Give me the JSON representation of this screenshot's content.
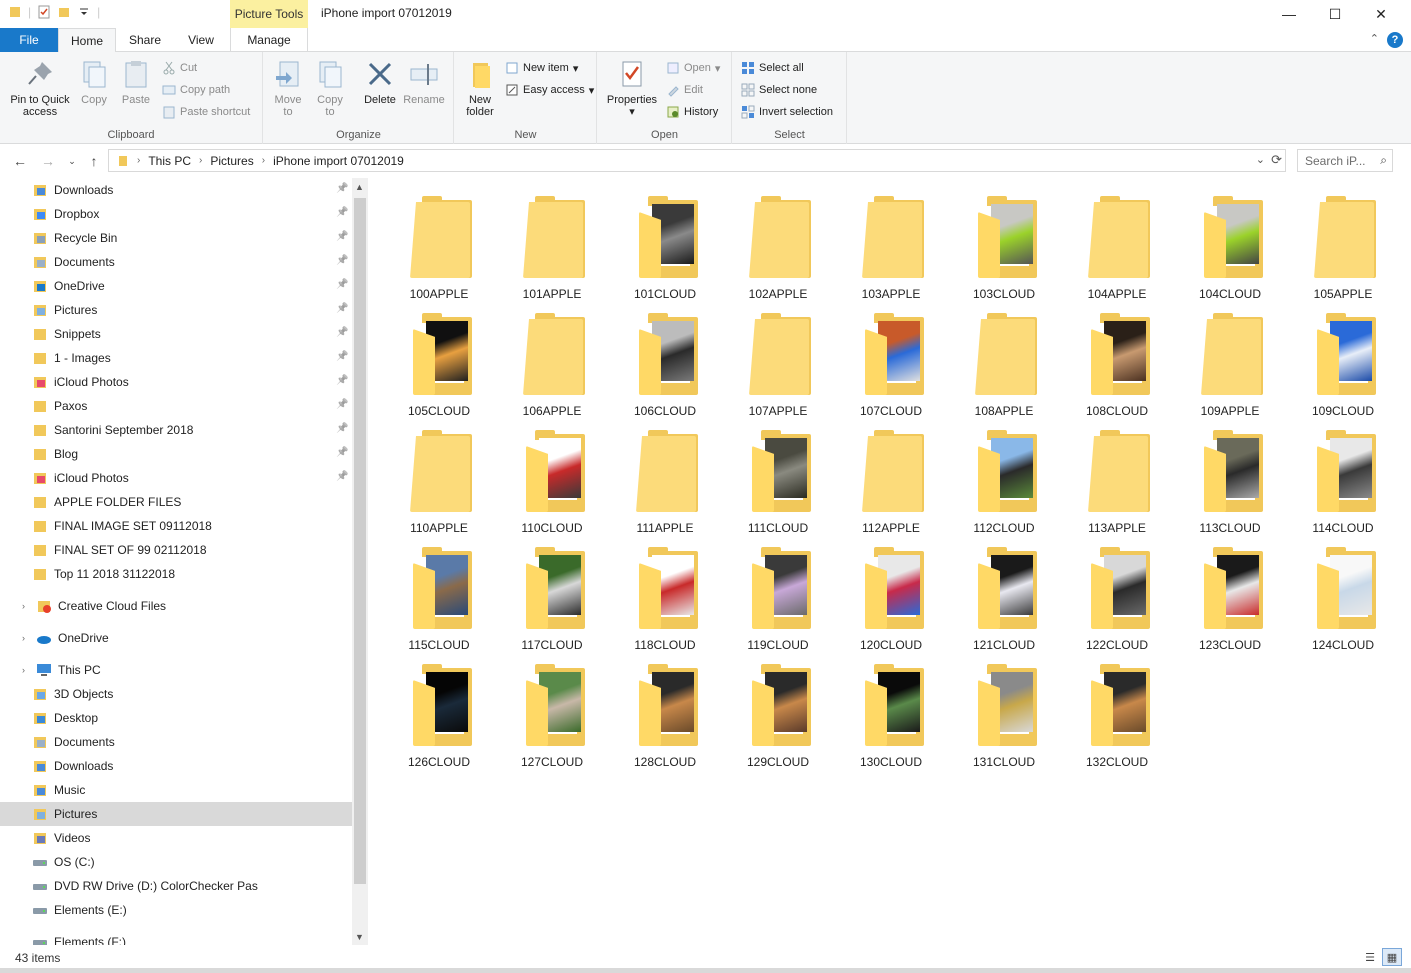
{
  "window": {
    "title": "iPhone import 07012019",
    "contextual_tab": "Picture Tools",
    "minimize_glyph": "—",
    "maximize_glyph": "☐",
    "close_glyph": "✕"
  },
  "tabs": [
    {
      "label": "File"
    },
    {
      "label": "Home"
    },
    {
      "label": "Share"
    },
    {
      "label": "View"
    },
    {
      "label": "Manage"
    }
  ],
  "ribbon": {
    "clipboard": {
      "label": "Clipboard",
      "pin": "Pin to Quick access",
      "copy": "Copy",
      "paste": "Paste",
      "cut": "Cut",
      "copy_path": "Copy path",
      "paste_shortcut": "Paste shortcut"
    },
    "organize": {
      "label": "Organize",
      "move_to": "Move to",
      "copy_to": "Copy to",
      "delete": "Delete",
      "rename": "Rename"
    },
    "new": {
      "label": "New",
      "new_folder": "New folder",
      "new_item": "New item",
      "easy_access": "Easy access"
    },
    "open": {
      "label": "Open",
      "properties": "Properties",
      "open": "Open",
      "edit": "Edit",
      "history": "History"
    },
    "select": {
      "label": "Select",
      "select_all": "Select all",
      "select_none": "Select none",
      "invert": "Invert selection"
    }
  },
  "address": {
    "crumbs": [
      "This PC",
      "Pictures",
      "iPhone import 07012019"
    ],
    "search_placeholder": "Search iP..."
  },
  "nav": {
    "quick_access": [
      {
        "label": "Downloads",
        "icon": "download-folder-icon",
        "pinned": true
      },
      {
        "label": "Dropbox",
        "icon": "dropbox-icon",
        "pinned": true
      },
      {
        "label": "Recycle Bin",
        "icon": "recycle-bin-icon",
        "pinned": true
      },
      {
        "label": "Documents",
        "icon": "documents-folder-icon",
        "pinned": true
      },
      {
        "label": "OneDrive",
        "icon": "onedrive-folder-icon",
        "pinned": true
      },
      {
        "label": "Pictures",
        "icon": "pictures-folder-icon",
        "pinned": true
      },
      {
        "label": "Snippets",
        "icon": "folder-icon",
        "pinned": true
      },
      {
        "label": "1 - Images",
        "icon": "folder-icon",
        "pinned": true
      },
      {
        "label": "iCloud Photos",
        "icon": "icloud-photos-icon",
        "pinned": true
      },
      {
        "label": "Paxos",
        "icon": "folder-icon",
        "pinned": true
      },
      {
        "label": "Santorini September 2018",
        "icon": "folder-icon",
        "pinned": true
      },
      {
        "label": "Blog",
        "icon": "folder-icon",
        "pinned": true
      },
      {
        "label": "iCloud Photos",
        "icon": "icloud-photos-icon",
        "pinned": true
      },
      {
        "label": "APPLE FOLDER FILES",
        "icon": "folder-icon",
        "pinned": false
      },
      {
        "label": "FINAL IMAGE SET 09112018",
        "icon": "folder-icon",
        "pinned": false
      },
      {
        "label": "FINAL SET OF 99 02112018",
        "icon": "folder-icon",
        "pinned": false
      },
      {
        "label": "Top 11 2018 31122018",
        "icon": "folder-icon",
        "pinned": false
      }
    ],
    "creative_cloud": "Creative Cloud Files",
    "onedrive": "OneDrive",
    "this_pc": "This PC",
    "this_pc_items": [
      {
        "label": "3D Objects",
        "icon": "3d-objects-icon"
      },
      {
        "label": "Desktop",
        "icon": "desktop-icon"
      },
      {
        "label": "Documents",
        "icon": "documents-folder-icon"
      },
      {
        "label": "Downloads",
        "icon": "download-folder-icon"
      },
      {
        "label": "Music",
        "icon": "music-folder-icon"
      },
      {
        "label": "Pictures",
        "icon": "pictures-folder-icon",
        "selected": true
      },
      {
        "label": "Videos",
        "icon": "videos-folder-icon"
      },
      {
        "label": "OS (C:)",
        "icon": "os-drive-icon"
      },
      {
        "label": "DVD RW Drive (D:) ColorChecker Pas",
        "icon": "dvd-drive-icon"
      },
      {
        "label": "Elements (E:)",
        "icon": "drive-icon"
      },
      {
        "label": "Elements (F:)",
        "icon": "drive-icon"
      }
    ]
  },
  "folders": [
    {
      "name": "100APPLE",
      "thumb": "empty"
    },
    {
      "name": "101APPLE",
      "thumb": "empty"
    },
    {
      "name": "101CLOUD",
      "thumb": "photo",
      "colors": [
        "#3a3a3a",
        "#8a8a8a",
        "#1a1a1a"
      ]
    },
    {
      "name": "102APPLE",
      "thumb": "empty"
    },
    {
      "name": "103APPLE",
      "thumb": "empty"
    },
    {
      "name": "103CLOUD",
      "thumb": "photo",
      "colors": [
        "#c8c8c4",
        "#9bd22a",
        "#555555"
      ]
    },
    {
      "name": "104APPLE",
      "thumb": "empty"
    },
    {
      "name": "104CLOUD",
      "thumb": "photo",
      "colors": [
        "#c8c8c4",
        "#9bd22a",
        "#444444"
      ]
    },
    {
      "name": "105APPLE",
      "thumb": "empty"
    },
    {
      "name": "105CLOUD",
      "thumb": "photo",
      "colors": [
        "#101010",
        "#e8a040",
        "#202020"
      ]
    },
    {
      "name": "106APPLE",
      "thumb": "empty"
    },
    {
      "name": "106CLOUD",
      "thumb": "photo",
      "colors": [
        "#bcbcbc",
        "#2a2a2a",
        "#7a7a7a"
      ]
    },
    {
      "name": "107APPLE",
      "thumb": "empty"
    },
    {
      "name": "107CLOUD",
      "thumb": "photo",
      "colors": [
        "#c85a2a",
        "#2a6ad8",
        "#e0e0e0"
      ]
    },
    {
      "name": "108APPLE",
      "thumb": "empty"
    },
    {
      "name": "108CLOUD",
      "thumb": "photo",
      "colors": [
        "#2a2018",
        "#c89a70",
        "#4a3020"
      ]
    },
    {
      "name": "109APPLE",
      "thumb": "empty"
    },
    {
      "name": "109CLOUD",
      "thumb": "photo",
      "colors": [
        "#2a6ad8",
        "#e8eef8",
        "#1a4aa8"
      ]
    },
    {
      "name": "110APPLE",
      "thumb": "empty"
    },
    {
      "name": "110CLOUD",
      "thumb": "photo",
      "colors": [
        "#ffffff",
        "#c82a2a",
        "#3a3a3a"
      ]
    },
    {
      "name": "111APPLE",
      "thumb": "empty"
    },
    {
      "name": "111CLOUD",
      "thumb": "photo",
      "colors": [
        "#4a4a40",
        "#8a8a80",
        "#2a2a20"
      ]
    },
    {
      "name": "112APPLE",
      "thumb": "empty"
    },
    {
      "name": "112CLOUD",
      "thumb": "photo",
      "colors": [
        "#8ab8e8",
        "#2a2a2a",
        "#5a8a3a"
      ]
    },
    {
      "name": "113APPLE",
      "thumb": "empty"
    },
    {
      "name": "113CLOUD",
      "thumb": "photo",
      "colors": [
        "#6a6a5a",
        "#2a2a2a",
        "#aaaaaa"
      ]
    },
    {
      "name": "114CLOUD",
      "thumb": "photo",
      "colors": [
        "#e8e8e8",
        "#3a3a3a",
        "#8a8a8a"
      ]
    },
    {
      "name": "115CLOUD",
      "thumb": "photo",
      "colors": [
        "#5a7aa8",
        "#8a6a4a",
        "#2a4a78"
      ]
    },
    {
      "name": "117CLOUD",
      "thumb": "photo",
      "colors": [
        "#3a6a2a",
        "#d8d8d8",
        "#2a2a2a"
      ]
    },
    {
      "name": "118CLOUD",
      "thumb": "photo",
      "colors": [
        "#ffffff",
        "#c82a2a",
        "#e8e8e8"
      ]
    },
    {
      "name": "119CLOUD",
      "thumb": "photo",
      "colors": [
        "#3a3a3a",
        "#c8a8d8",
        "#6a6a6a"
      ]
    },
    {
      "name": "120CLOUD",
      "thumb": "photo",
      "colors": [
        "#e8e8e8",
        "#c82a4a",
        "#2a6ad8"
      ]
    },
    {
      "name": "121CLOUD",
      "thumb": "photo",
      "colors": [
        "#1a1a1a",
        "#e8e8f0",
        "#3a3a3a"
      ]
    },
    {
      "name": "122CLOUD",
      "thumb": "photo",
      "colors": [
        "#d8d8d8",
        "#2a2a2a",
        "#6a6a6a"
      ]
    },
    {
      "name": "123CLOUD",
      "thumb": "photo",
      "colors": [
        "#1a1a1a",
        "#e8e8e8",
        "#c82a2a"
      ]
    },
    {
      "name": "124CLOUD",
      "thumb": "photo",
      "colors": [
        "#f8f8f8",
        "#c8d8e8",
        "#e8e8e8"
      ]
    },
    {
      "name": "126CLOUD",
      "thumb": "photo",
      "colors": [
        "#050505",
        "#1a2a3a",
        "#0a0a0a"
      ]
    },
    {
      "name": "127CLOUD",
      "thumb": "photo",
      "colors": [
        "#5a8a4a",
        "#c8b8a8",
        "#3a6a2a"
      ]
    },
    {
      "name": "128CLOUD",
      "thumb": "photo",
      "colors": [
        "#2a2a2a",
        "#c8884a",
        "#6a4a2a"
      ]
    },
    {
      "name": "129CLOUD",
      "thumb": "photo",
      "colors": [
        "#2a2a2a",
        "#c8884a",
        "#5a3a2a"
      ]
    },
    {
      "name": "130CLOUD",
      "thumb": "photo",
      "colors": [
        "#0a0a0a",
        "#5a8a4a",
        "#1a1a1a"
      ]
    },
    {
      "name": "131CLOUD",
      "thumb": "photo",
      "colors": [
        "#8a8a8a",
        "#c8a84a",
        "#d8d8d8"
      ]
    },
    {
      "name": "132CLOUD",
      "thumb": "photo",
      "colors": [
        "#2a2a2a",
        "#c8884a",
        "#6a4a2a"
      ]
    }
  ],
  "status": {
    "count": "43 items"
  },
  "colors": {
    "file_tab": "#1979ca",
    "picture_tools": "#fbf0a0",
    "folder_front": "#ffd966",
    "folder_back": "#f1c85a",
    "selection": "#d9d9d9"
  }
}
